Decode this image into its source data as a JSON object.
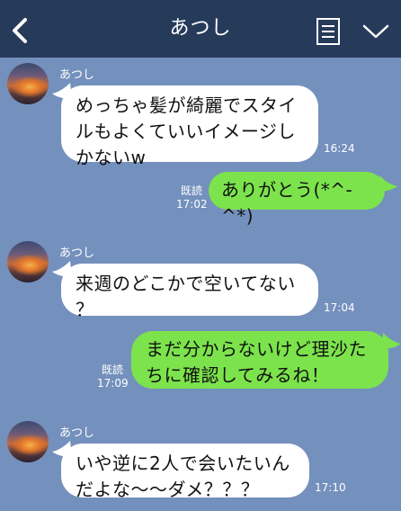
{
  "header": {
    "title": "あつし",
    "back_icon": "chevron-left-icon",
    "menu_icon": "document-list-icon",
    "expand_icon": "chevron-down-icon",
    "background": "#263a5a"
  },
  "chat": {
    "background": "#7490bd",
    "incoming_bubble_color": "#ffffff",
    "outgoing_bubble_color": "#7ce34c",
    "messages": [
      {
        "direction": "in",
        "sender": "あつし",
        "text": "めっちゃ髪が綺麗でスタイ\nルもよくていいイメージし\nかないw",
        "time": "16:24"
      },
      {
        "direction": "out",
        "read": "既読",
        "text": "ありがとう(*^-^*)",
        "time": "17:02"
      },
      {
        "direction": "in",
        "sender": "あつし",
        "text": "来週のどこかで空いてない\n？",
        "time": "17:04"
      },
      {
        "direction": "out",
        "read": "既読",
        "text": "まだ分からないけど理沙た\nちに確認してみるね！",
        "time": "17:09"
      },
      {
        "direction": "in",
        "sender": "あつし",
        "text": "いや逆に2人で会いたいん\nだよな〜〜ダメ？？？",
        "time": "17:10"
      }
    ]
  }
}
